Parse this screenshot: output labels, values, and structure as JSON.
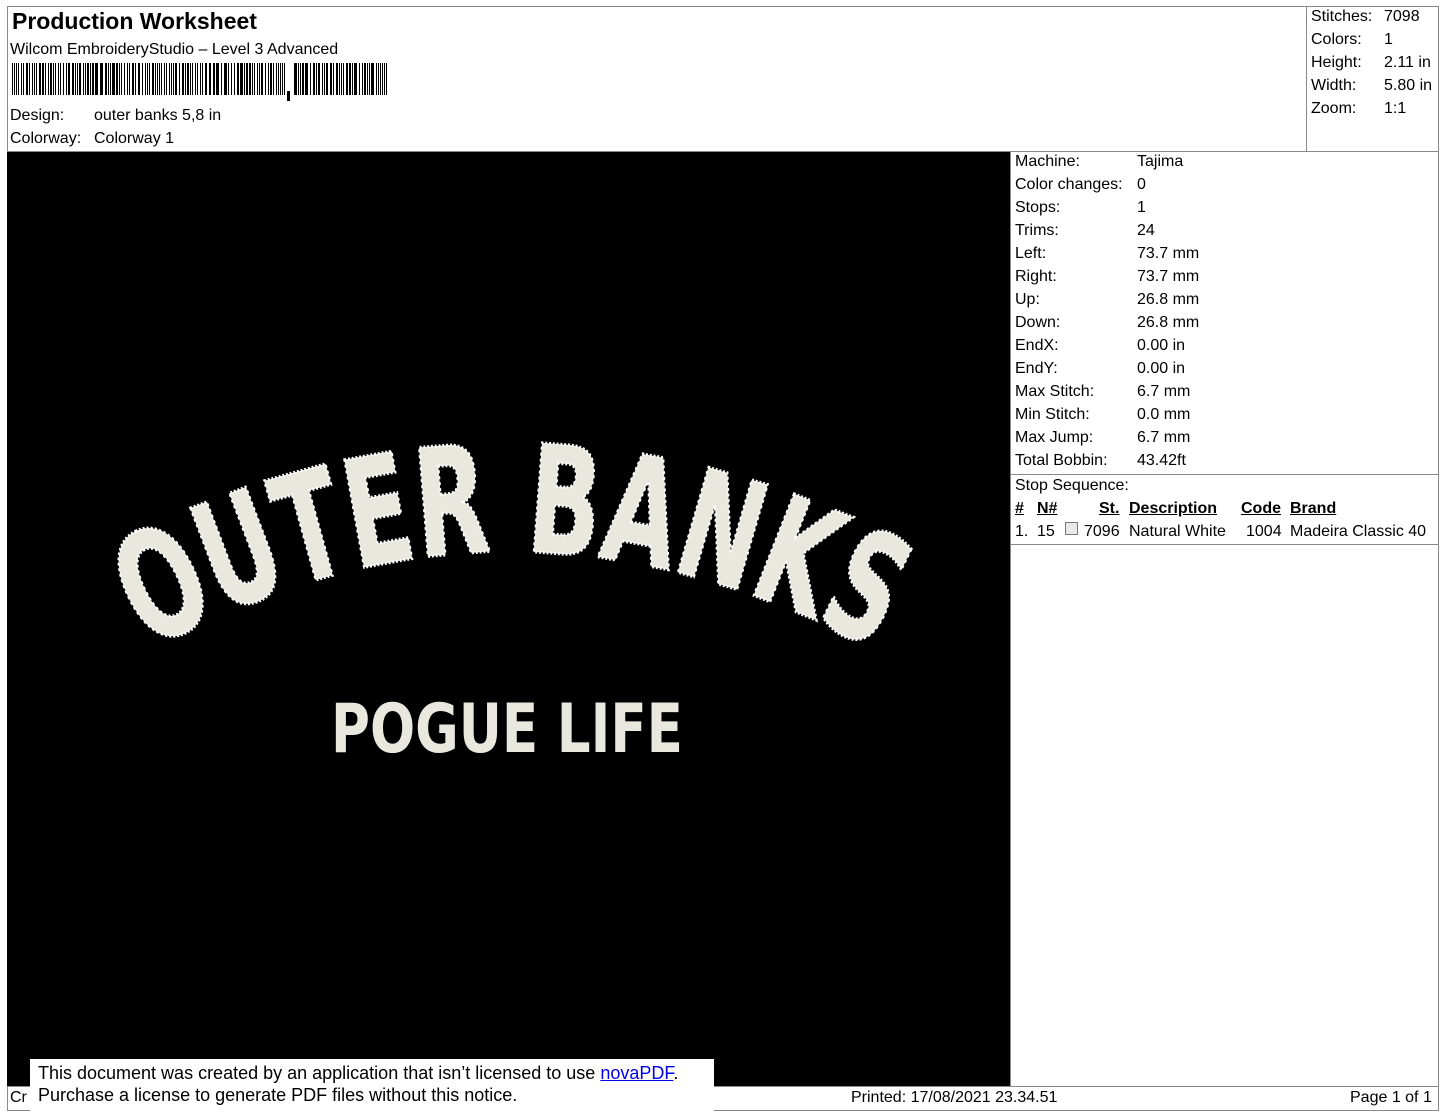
{
  "header": {
    "title": "Production Worksheet",
    "software": "Wilcom EmbroideryStudio – Level 3 Advanced",
    "design_label": "Design:",
    "design_value": "outer banks  5,8 in",
    "colorway_label": "Colorway:",
    "colorway_value": "Colorway 1"
  },
  "stats": {
    "stitches_label": "Stitches:",
    "stitches_value": "7098",
    "colors_label": "Colors:",
    "colors_value": "1",
    "height_label": "Height:",
    "height_value": "2.11 in",
    "width_label": "Width:",
    "width_value": "5.80 in",
    "zoom_label": "Zoom:",
    "zoom_value": "1:1"
  },
  "design": {
    "line1": "OUTER BANKS",
    "line2": "POGUE LIFE",
    "thread_color": "#e8e8de",
    "background": "#000000"
  },
  "info": [
    {
      "label": "Machine:",
      "value": "Tajima"
    },
    {
      "label": "Color changes:",
      "value": "0"
    },
    {
      "label": "Stops:",
      "value": "1"
    },
    {
      "label": "Trims:",
      "value": "24"
    },
    {
      "label": "Left:",
      "value": "73.7 mm"
    },
    {
      "label": "Right:",
      "value": "73.7 mm"
    },
    {
      "label": "Up:",
      "value": "26.8 mm"
    },
    {
      "label": "Down:",
      "value": "26.8 mm"
    },
    {
      "label": "EndX:",
      "value": "0.00 in"
    },
    {
      "label": "EndY:",
      "value": "0.00 in"
    },
    {
      "label": "Max Stitch:",
      "value": "6.7 mm"
    },
    {
      "label": "Min Stitch:",
      "value": "0.0 mm"
    },
    {
      "label": "Max Jump:",
      "value": "6.7 mm"
    },
    {
      "label": "Total Bobbin:",
      "value": "43.42ft"
    }
  ],
  "stop_sequence": {
    "title": "Stop Sequence:",
    "headers": {
      "num": "#",
      "n": "N#",
      "st": "St.",
      "description": "Description",
      "code": "Code",
      "brand": "Brand"
    },
    "rows": [
      {
        "num": "1.",
        "n": "15",
        "st": "7096",
        "description": "Natural White",
        "code": "1004",
        "brand": "Madeira Classic 40",
        "swatch_color": "#e9e9e9"
      }
    ]
  },
  "footer": {
    "cr": "Cr",
    "printed": "Printed: 17/08/2021 23.34.51",
    "page": "Page 1 of 1",
    "notice_line1_pre": "This document was created by an application that isn’t licensed to use ",
    "notice_link": "novaPDF",
    "notice_line1_post": ".",
    "notice_line2": "Purchase a license to generate PDF files without this notice."
  }
}
